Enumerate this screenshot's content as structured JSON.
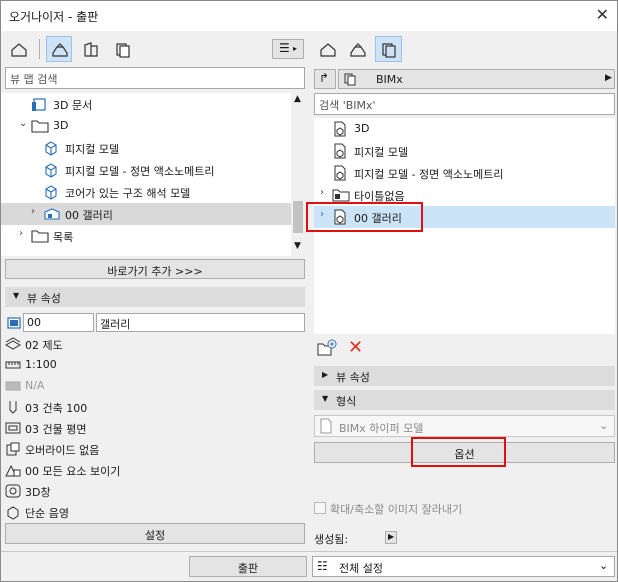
{
  "window": {
    "title": "오거나이저 - 출판",
    "close_glyph": "✕"
  },
  "left_panel": {
    "search_placeholder": "뷰 맵 검색",
    "tree": [
      {
        "label": "3D 문서",
        "icon": "3d-document-icon"
      },
      {
        "label": "3D",
        "icon": "folder-icon",
        "expanded": true
      },
      {
        "label": "피지컬 모델",
        "icon": "3d-view-icon"
      },
      {
        "label": "피지컬 모델 - 정면 액소노메트리",
        "icon": "3d-view-icon"
      },
      {
        "label": "코어가 있는 구조 해석 모델",
        "icon": "3d-view-icon"
      },
      {
        "label": "00 갤러리",
        "icon": "gallery-icon",
        "selected": true
      },
      {
        "label": "목록",
        "icon": "folder-icon"
      }
    ],
    "add_shortcut_label": "바로가기 추가 >>>",
    "view_properties": {
      "header": "뷰 속성",
      "id": "00",
      "name": "갤러리",
      "rows": [
        {
          "label": "02 제도",
          "icon": "layer-icon",
          "muted": false
        },
        {
          "label": "1:100",
          "icon": "scale-icon",
          "muted": false
        },
        {
          "label": "N/A",
          "icon": "structure-icon",
          "muted": true
        },
        {
          "label": "03 건축 100",
          "icon": "pen-set-icon",
          "muted": false
        },
        {
          "label": "03 건물 평면",
          "icon": "model-view-icon",
          "muted": false
        },
        {
          "label": "오버라이드 없음",
          "icon": "override-icon",
          "muted": false
        },
        {
          "label": "00 모든 요소 보이기",
          "icon": "renovation-icon",
          "muted": false
        },
        {
          "label": "3D창",
          "icon": "3d-window-icon",
          "muted": false
        },
        {
          "label": "단순 음영",
          "icon": "shading-icon",
          "muted": false
        }
      ],
      "settings_button": "설정"
    }
  },
  "right_panel": {
    "path_label": "BIMx",
    "search_placeholder": "검색 'BIMx'",
    "tree": [
      {
        "label": "3D",
        "icon": "publish-3d-icon"
      },
      {
        "label": "피지컬 모델",
        "icon": "publish-3d-icon"
      },
      {
        "label": "피지컬 모델 - 정면 액소노메트리",
        "icon": "publish-3d-icon"
      },
      {
        "label": "타이틀없음",
        "icon": "publish-folder-icon"
      },
      {
        "label": "00 갤러리",
        "icon": "publish-3d-icon",
        "selected": true
      }
    ],
    "view_properties_header": "뷰 속성",
    "format_header": "형식",
    "format_value": "BIMx 하이퍼 모델",
    "options_button": "옵션",
    "crop_checkbox_label": "확대/축소할 이미지 잘라내기",
    "generated_label": "생성됨:"
  },
  "footer": {
    "publish_button": "출판",
    "scope_value": "전체 설정"
  },
  "colors": {
    "selection_blue": "#cce4f7",
    "highlight_red": "#e01010",
    "header_gray": "#dcdcdc",
    "delete_red": "#e53020"
  }
}
